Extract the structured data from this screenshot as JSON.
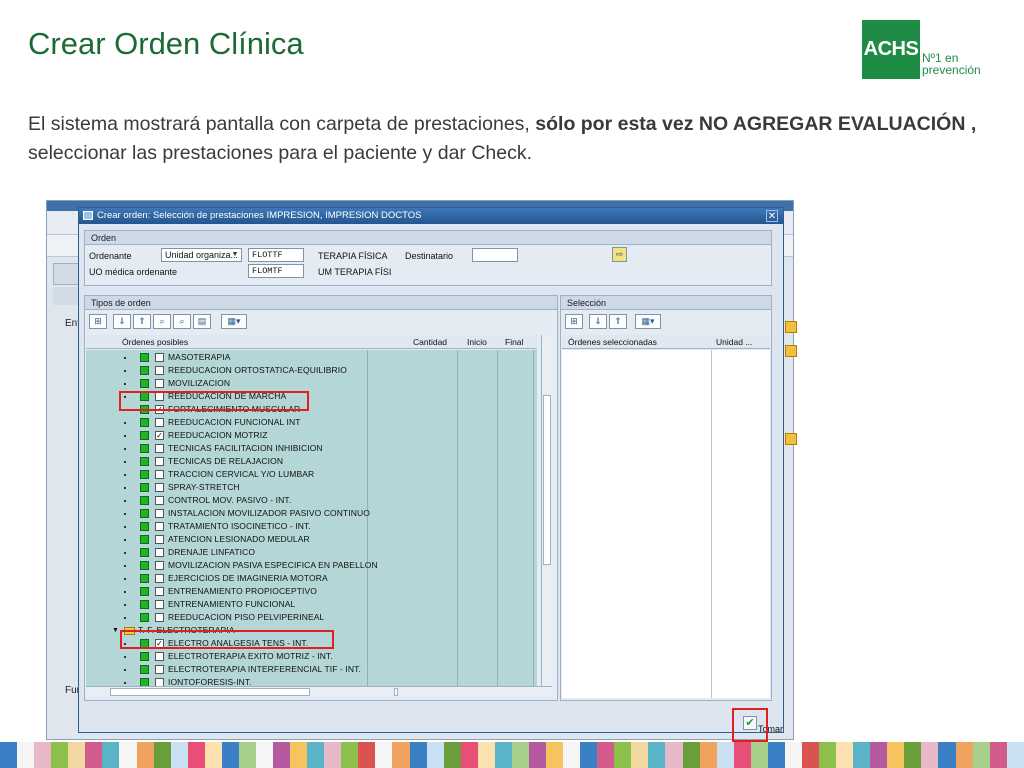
{
  "slide": {
    "title": "Crear Orden Clínica",
    "intro_part1": "El  sistema mostrará pantalla con carpeta de prestaciones, ",
    "intro_bold": "sólo por esta vez NO AGREGAR EVALUACIÓN ,",
    "intro_part2": " seleccionar las prestaciones para el paciente y dar Check.",
    "logo_text": "ACHS",
    "logo_tag_line1": "Nº1 en",
    "logo_tag_line2": "prevención",
    "brand_color": "#1e8c45",
    "title_color": "#1c6b35",
    "highlight_color": "#e01f1f"
  },
  "background_window": {
    "title": "Crear orden: Selección de prestaciones IMPRESION, IMPRESION DOCTOS",
    "side_label_1": "Ent",
    "side_label_2": "Fun"
  },
  "dialog": {
    "title": "Crear orden: Selección de prestaciones IMPRESION, IMPRESION DOCTOS",
    "orden": {
      "header": "Orden",
      "ordenante_label": "Ordenante",
      "ordenante_select": "Unidad organiza...",
      "ordenante_code": "FLOTTF",
      "ordenante_name": "TERAPIA FÍSICA",
      "destinatario_label": "Destinatario",
      "destinatario_value": "",
      "uo_label": "UO médica ordenante",
      "uo_code": "FLOMTF",
      "uo_name": "UM TERAPIA FÍSI"
    },
    "tipos": {
      "header": "Tipos de orden",
      "columns": [
        "Órdenes posibles",
        "Cantidad",
        "Inicio",
        "Final"
      ],
      "items": [
        {
          "label": "MASOTERAPIA",
          "checked": false,
          "folder": false
        },
        {
          "label": "REEDUCACION ORTOSTATICA-EQUILIBRIO",
          "checked": false,
          "folder": false
        },
        {
          "label": "MOVILIZACION",
          "checked": false,
          "folder": false
        },
        {
          "label": "REEDUCACION DE MARCHA",
          "checked": false,
          "folder": false
        },
        {
          "label": "FORTALECIMIENTO MUSCULAR",
          "checked": true,
          "folder": false
        },
        {
          "label": "REEDUCACION FUNCIONAL INT",
          "checked": false,
          "folder": false
        },
        {
          "label": "REEDUCACION MOTRIZ",
          "checked": true,
          "folder": false
        },
        {
          "label": "TECNICAS FACILITACION INHIBICION",
          "checked": false,
          "folder": false
        },
        {
          "label": "TECNICAS DE RELAJACION",
          "checked": false,
          "folder": false
        },
        {
          "label": "TRACCION CERVICAL Y/O LUMBAR",
          "checked": false,
          "folder": false
        },
        {
          "label": "SPRAY-STRETCH",
          "checked": false,
          "folder": false
        },
        {
          "label": "CONTROL MOV. PASIVO - INT.",
          "checked": false,
          "folder": false
        },
        {
          "label": "INSTALACION MOVILIZADOR PASIVO CONTINUO",
          "checked": false,
          "folder": false
        },
        {
          "label": "TRATAMIENTO ISOCINETICO - INT.",
          "checked": false,
          "folder": false
        },
        {
          "label": "ATENCION LESIONADO MEDULAR",
          "checked": false,
          "folder": false
        },
        {
          "label": "DRENAJE LINFATICO",
          "checked": false,
          "folder": false
        },
        {
          "label": "MOVILIZACION PASIVA ESPECIFICA EN PABELLON",
          "checked": false,
          "folder": false
        },
        {
          "label": "EJERCICIOS DE IMAGINERIA MOTORA",
          "checked": false,
          "folder": false
        },
        {
          "label": "ENTRENAMIENTO PROPIOCEPTIVO",
          "checked": false,
          "folder": false
        },
        {
          "label": "ENTRENAMIENTO FUNCIONAL",
          "checked": false,
          "folder": false
        },
        {
          "label": "REEDUCACION PISO PELVIPERINEAL",
          "checked": false,
          "folder": false
        },
        {
          "label": "T. F. ELECTROTERAPIA",
          "checked": false,
          "folder": true
        },
        {
          "label": "ELECTRO ANALGESIA TENS - INT.",
          "checked": true,
          "folder": false
        },
        {
          "label": "ELECTROTERAPIA EXITO MOTRIZ - INT.",
          "checked": false,
          "folder": false
        },
        {
          "label": "ELECTROTERAPIA INTERFERENCIAL TIF - INT.",
          "checked": false,
          "folder": false
        },
        {
          "label": "IONTOFORESIS-INT.",
          "checked": false,
          "folder": false
        }
      ]
    },
    "seleccion": {
      "header": "Selección",
      "columns": [
        "Órdenes seleccionadas",
        "Unidad ..."
      ]
    },
    "tomar_label": "Tomar"
  }
}
